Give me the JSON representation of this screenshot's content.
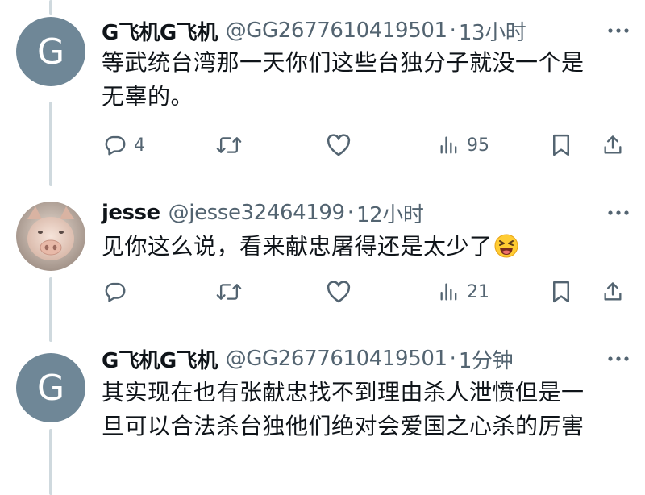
{
  "tweets": [
    {
      "avatar_letter": "G",
      "name": "G飞机G飞机",
      "handle": "@GG2677610419501",
      "separator": "·",
      "time": "13小时",
      "text": "等武统台湾那一天你们这些台独分子就没一个是无辜的。",
      "replies": "4",
      "views": "95"
    },
    {
      "avatar_description": "pig",
      "name": "jesse",
      "handle": "@jesse32464199",
      "separator": "·",
      "time": "12小时",
      "text": "见你这么说，看来献忠屠得还是太少了",
      "emoji": "laughing",
      "replies": "",
      "views": "21"
    },
    {
      "avatar_letter": "G",
      "name": "G飞机G飞机",
      "handle": "@GG2677610419501",
      "separator": "·",
      "time": "1分钟",
      "text": "其实现在也有张献忠找不到理由杀人泄愤但是一旦可以合法杀台独他们绝对会爱国之心杀的厉害"
    }
  ],
  "colors": {
    "text_primary": "#0f1419",
    "text_secondary": "#536471",
    "avatar_bg": "#6f8797",
    "thread_line": "#cfd9de"
  }
}
